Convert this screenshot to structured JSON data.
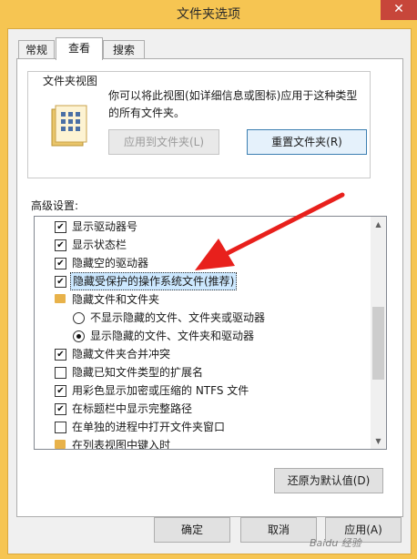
{
  "window": {
    "title": "文件夹选项",
    "close_glyph": "✕",
    "close_color": "#c7463a",
    "frame_color": "#f6c552"
  },
  "tabs": [
    {
      "label": "常规",
      "active": false
    },
    {
      "label": "查看",
      "active": true
    },
    {
      "label": "搜索",
      "active": false
    }
  ],
  "folder_views": {
    "legend": "文件夹视图",
    "description": "你可以将此视图(如详细信息或图标)应用于这种类型的所有文件夹。",
    "apply_button": "应用到文件夹(L)",
    "reset_button": "重置文件夹(R)",
    "icon": "folder-views-icon"
  },
  "advanced": {
    "label": "高级设置:",
    "items": [
      {
        "type": "checkbox",
        "checked": true,
        "label": "显示驱动器号"
      },
      {
        "type": "checkbox",
        "checked": true,
        "label": "显示状态栏"
      },
      {
        "type": "checkbox",
        "checked": true,
        "label": "隐藏空的驱动器"
      },
      {
        "type": "checkbox",
        "checked": true,
        "label": "隐藏受保护的操作系统文件(推荐)",
        "selected": true
      },
      {
        "type": "folder",
        "label": "隐藏文件和文件夹"
      },
      {
        "type": "radio",
        "checked": false,
        "label": "不显示隐藏的文件、文件夹或驱动器"
      },
      {
        "type": "radio",
        "checked": true,
        "label": "显示隐藏的文件、文件夹和驱动器"
      },
      {
        "type": "checkbox",
        "checked": true,
        "label": "隐藏文件夹合并冲突"
      },
      {
        "type": "checkbox",
        "checked": false,
        "label": "隐藏已知文件类型的扩展名"
      },
      {
        "type": "checkbox",
        "checked": true,
        "label": "用彩色显示加密或压缩的 NTFS 文件"
      },
      {
        "type": "checkbox",
        "checked": true,
        "label": "在标题栏中显示完整路径"
      },
      {
        "type": "checkbox",
        "checked": false,
        "label": "在单独的进程中打开文件夹窗口"
      },
      {
        "type": "folder",
        "label": "在列表视图中键入时"
      }
    ],
    "restore_button": "还原为默认值(D)"
  },
  "footer": {
    "ok": "确定",
    "cancel": "取消",
    "apply": "应用(A)"
  },
  "annotation": {
    "arrow_color": "#e8201c"
  },
  "watermark": "Baidu 经验"
}
